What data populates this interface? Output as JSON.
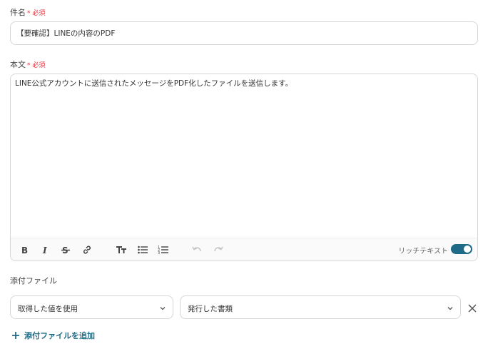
{
  "subject": {
    "label": "件名",
    "required_mark": "* 必須",
    "value": "【要確認】LINEの内容のPDF"
  },
  "body": {
    "label": "本文",
    "required_mark": "* 必須",
    "value": "LINE公式アカウントに送信されたメッセージをPDF化したファイルを送信します。",
    "toolbar": {
      "icons": [
        "bold-icon",
        "italic-icon",
        "strikethrough-icon",
        "link-icon",
        "text-size-icon",
        "bullet-list-icon",
        "numbered-list-icon",
        "undo-icon",
        "redo-icon"
      ],
      "rich_text_label": "リッチテキスト",
      "rich_text_enabled": true
    }
  },
  "attachment": {
    "label": "添付ファイル",
    "source_select": "取得した値を使用",
    "document_select": "発行した書類",
    "add_label": "添付ファイルを追加"
  },
  "colors": {
    "accent": "#1f6b87",
    "required": "#e0313c",
    "border": "#d6d6d6"
  }
}
